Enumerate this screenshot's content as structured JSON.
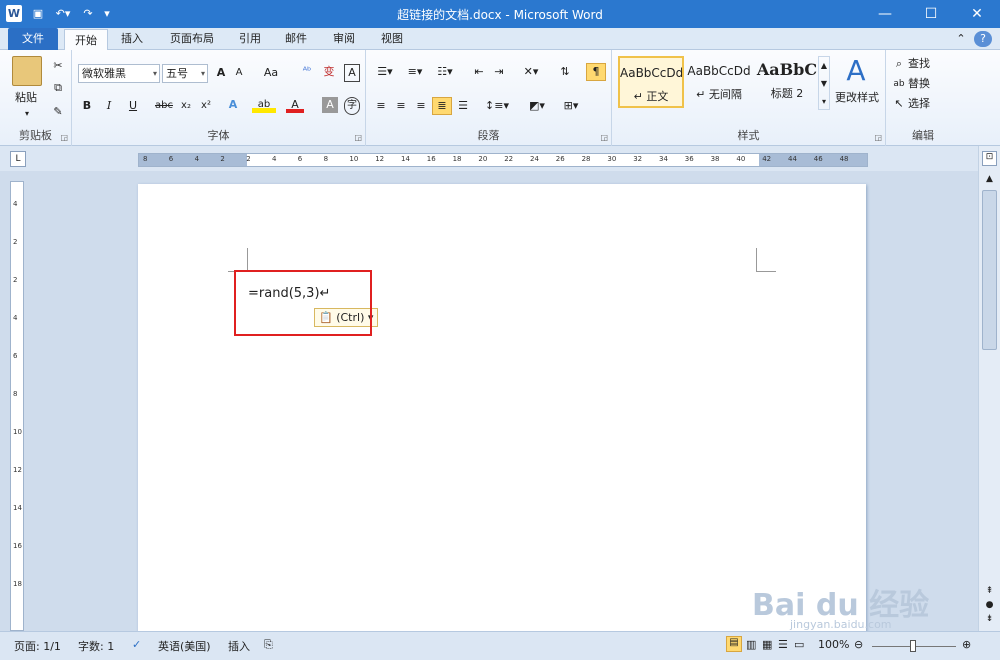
{
  "window": {
    "title": "超链接的文档.docx - Microsoft Word"
  },
  "tabs": {
    "file": "文件",
    "home": "开始",
    "insert": "插入",
    "layout": "页面布局",
    "references": "引用",
    "mailings": "邮件",
    "review": "审阅",
    "view": "视图"
  },
  "clipboard": {
    "paste": "粘贴",
    "label": "剪贴板"
  },
  "font": {
    "family": "微软雅黑",
    "size": "五号",
    "label": "字体",
    "aa": "Aa"
  },
  "paragraph": {
    "label": "段落"
  },
  "styles": {
    "label": "样式",
    "items": [
      {
        "preview": "AaBbCcDd",
        "name": "↵ 正文"
      },
      {
        "preview": "AaBbCcDd",
        "name": "↵ 无间隔"
      },
      {
        "preview": "AaBbC",
        "name": "标题 2"
      }
    ],
    "change": "更改样式"
  },
  "editing": {
    "find": "查找",
    "replace": "替换",
    "select": "选择",
    "label": "编辑"
  },
  "ruler": {
    "ticks": [
      "8",
      "6",
      "4",
      "2",
      "2",
      "4",
      "6",
      "8",
      "10",
      "12",
      "14",
      "16",
      "18",
      "20",
      "22",
      "24",
      "26",
      "28",
      "30",
      "32",
      "34",
      "36",
      "38",
      "40",
      "42",
      "44",
      "46",
      "48"
    ],
    "vticks": [
      "4",
      "2",
      "2",
      "4",
      "6",
      "8",
      "10",
      "12",
      "14",
      "16",
      "18"
    ]
  },
  "document": {
    "text": "=rand(5,3)↵",
    "paste_option": "(Ctrl)"
  },
  "status": {
    "page": "页面: 1/1",
    "words": "字数: 1",
    "language": "英语(美国)",
    "mode": "插入",
    "zoom": "100%"
  },
  "watermark": {
    "brand": "Bai du 经验",
    "url": "jingyan.baidu.com"
  },
  "colors": {
    "titlebar": "#2b78cf",
    "highlight_box": "#e02020",
    "accent": "#f0c24a"
  }
}
